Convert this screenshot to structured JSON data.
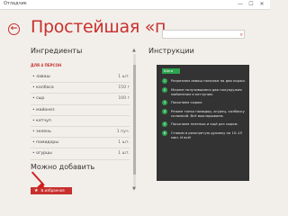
{
  "window": {
    "title": "Отладчик",
    "minimize_glyph": "—",
    "maximize_glyph": "☐",
    "close_glyph": "✕"
  },
  "header": {
    "back_icon": "back-arrow-icon",
    "back_glyph": "←",
    "title": "Простейшая «пиц...",
    "search": {
      "value": "",
      "placeholder": "",
      "icon": "search-icon",
      "glyph": "⌕"
    }
  },
  "ingredients": {
    "heading": "Ингредиенты",
    "servings_label": "ДЛЯ 4 ПЕРСОН",
    "items": [
      {
        "name": "• лаваш",
        "qty": "1 шт."
      },
      {
        "name": "• колбаса",
        "qty": "150 г"
      },
      {
        "name": "• сыр",
        "qty": "100 г"
      },
      {
        "name": "• майонез",
        "qty": ""
      },
      {
        "name": "• кетчуп",
        "qty": ""
      },
      {
        "name": "• зелень",
        "qty": "1 пуч."
      },
      {
        "name": "• помидоры",
        "qty": "1 шт."
      },
      {
        "name": "• огурцы",
        "qty": "1 шт."
      }
    ]
  },
  "scroll": {
    "up_glyph": "▲",
    "down_glyph": "▼"
  },
  "can_add": {
    "heading": "Можно добавить",
    "favorite_button": "В избранное",
    "star_glyph": "★"
  },
  "instructions": {
    "heading": "Инструкции",
    "tag": "Шаги",
    "steps": [
      {
        "num": "1",
        "text": "Разрезаем лаваш пополам на два коржа."
      },
      {
        "num": "2",
        "text": "Мажем получившиеся два полукружия майонезом и кетчупом."
      },
      {
        "num": "3",
        "text": "Посыпаем сыром."
      },
      {
        "num": "4",
        "text": "Режем тонко помидор, огурец, колбаску соломкой. Всё выкладываем."
      },
      {
        "num": "5",
        "text": "Посыпаем зеленью и ещё раз сыром."
      },
      {
        "num": "6",
        "text": "Ставим в разогретую духовку на 10–15 мин. И всё!"
      }
    ]
  },
  "colors": {
    "accent": "#c8302e",
    "step_green": "#2da44e",
    "panel": "#333333"
  }
}
